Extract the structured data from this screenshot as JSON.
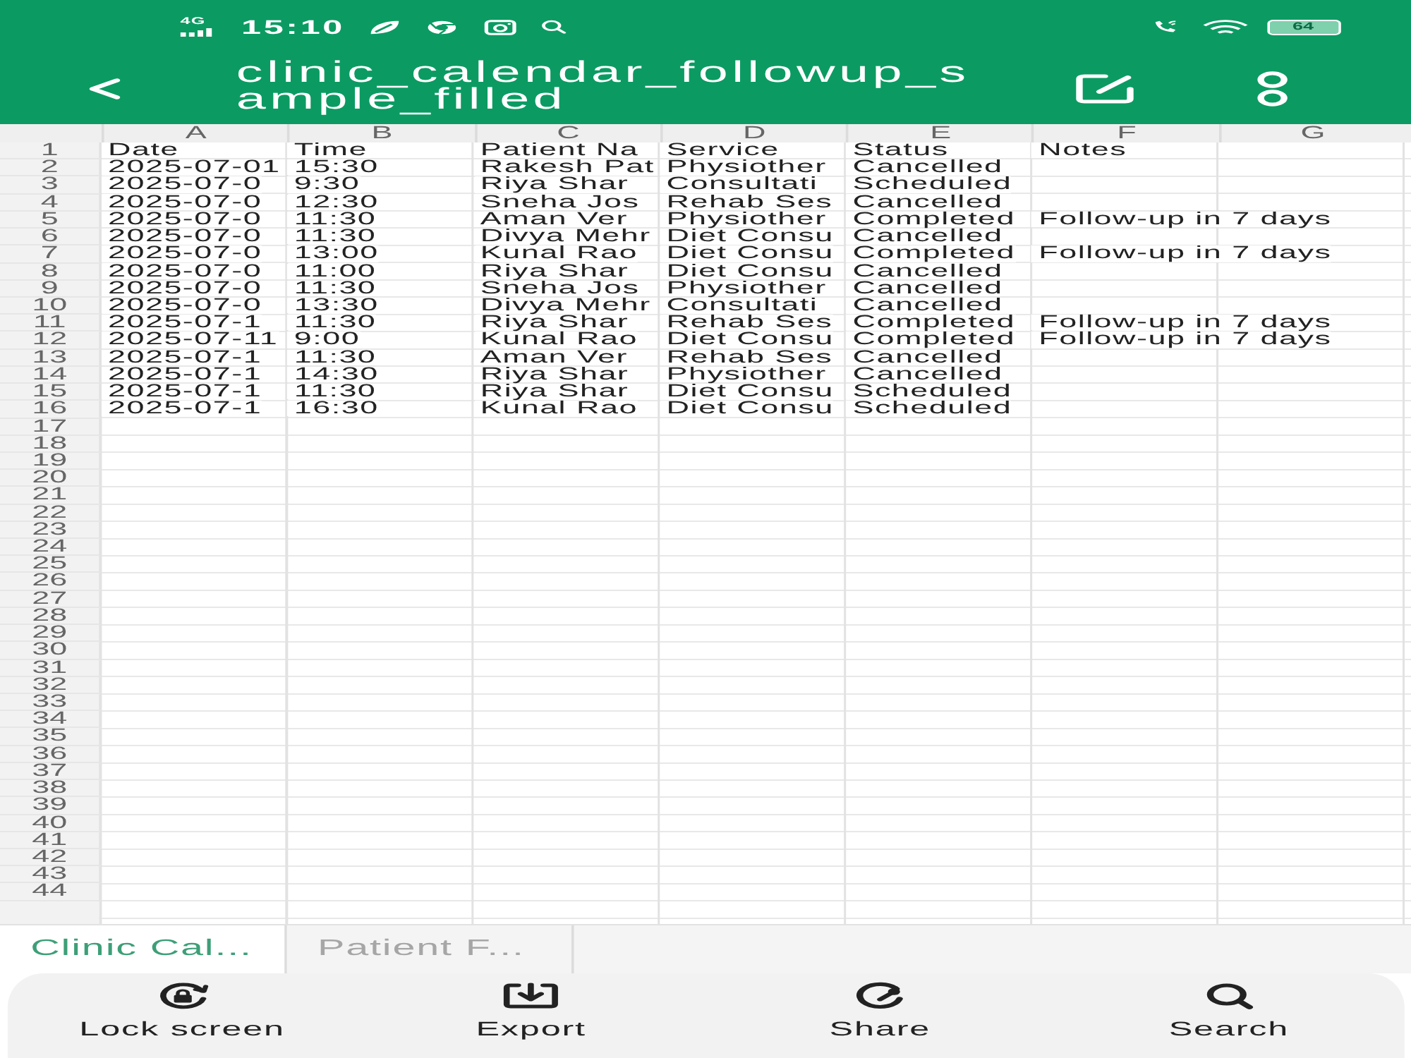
{
  "status_bar": {
    "network": "4G",
    "time": "15:10",
    "battery": "64"
  },
  "title_bar": {
    "title": "clinic_calendar_followup_sample_filled"
  },
  "sheet": {
    "columns": [
      "A",
      "B",
      "C",
      "D",
      "E",
      "F",
      "G"
    ],
    "rows": [
      {
        "number": "1",
        "cells": [
          "Date",
          "Time",
          "Patient Na",
          "Service",
          "Status",
          "Notes"
        ]
      },
      {
        "number": "2",
        "cells": [
          "2025-07-01",
          "15:30",
          "Rakesh Pat",
          "Physiother",
          "Cancelled"
        ]
      },
      {
        "number": "3",
        "cells": [
          "2025-07-0",
          "9:30",
          "Riya Shar",
          "Consultati",
          "Scheduled"
        ]
      },
      {
        "number": "4",
        "cells": [
          "2025-07-0",
          "12:30",
          "Sneha Jos",
          "Rehab Ses",
          "Cancelled"
        ]
      },
      {
        "number": "5",
        "cells": [
          "2025-07-0",
          "11:30",
          "Aman Ver",
          "Physiother",
          "Completed",
          "Follow-up in 7 days"
        ]
      },
      {
        "number": "6",
        "cells": [
          "2025-07-0",
          "11:30",
          "Divya Mehr",
          "Diet Consu",
          "Cancelled"
        ]
      },
      {
        "number": "7",
        "cells": [
          "2025-07-0",
          "13:00",
          "Kunal Rao",
          "Diet Consu",
          "Completed",
          "Follow-up in 7 days"
        ]
      },
      {
        "number": "8",
        "cells": [
          "2025-07-0",
          "11:00",
          "Riya Shar",
          "Diet Consu",
          "Cancelled"
        ]
      },
      {
        "number": "9",
        "cells": [
          "2025-07-0",
          "11:30",
          "Sneha Jos",
          "Physiother",
          "Cancelled"
        ]
      },
      {
        "number": "10",
        "cells": [
          "2025-07-0",
          "13:30",
          "Divya Mehr",
          "Consultati",
          "Cancelled"
        ]
      },
      {
        "number": "11",
        "cells": [
          "2025-07-1",
          "11:30",
          "Riya Shar",
          "Rehab Ses",
          "Completed",
          "Follow-up in 7 days"
        ]
      },
      {
        "number": "12",
        "cells": [
          "2025-07-11",
          "9:00",
          "Kunal Rao",
          "Diet Consu",
          "Completed",
          "Follow-up in 7 days"
        ]
      },
      {
        "number": "13",
        "cells": [
          "2025-07-1",
          "11:30",
          "Aman Ver",
          "Rehab Ses",
          "Cancelled"
        ]
      },
      {
        "number": "14",
        "cells": [
          "2025-07-1",
          "14:30",
          "Riya Shar",
          "Physiother",
          "Cancelled"
        ]
      },
      {
        "number": "15",
        "cells": [
          "2025-07-1",
          "11:30",
          "Riya Shar",
          "Diet Consu",
          "Scheduled"
        ]
      },
      {
        "number": "16",
        "cells": [
          "2025-07-1",
          "16:30",
          "Kunal Rao",
          "Diet Consu",
          "Scheduled"
        ]
      },
      {
        "number": "17"
      },
      {
        "number": "18"
      },
      {
        "number": "19"
      },
      {
        "number": "20"
      },
      {
        "number": "21"
      },
      {
        "number": "22"
      },
      {
        "number": "23"
      },
      {
        "number": "24"
      },
      {
        "number": "25"
      },
      {
        "number": "26"
      },
      {
        "number": "27"
      },
      {
        "number": "28"
      },
      {
        "number": "29"
      },
      {
        "number": "30"
      },
      {
        "number": "31"
      },
      {
        "number": "32"
      },
      {
        "number": "33"
      },
      {
        "number": "34"
      },
      {
        "number": "35"
      },
      {
        "number": "36"
      },
      {
        "number": "37"
      },
      {
        "number": "38"
      },
      {
        "number": "39"
      },
      {
        "number": "40"
      },
      {
        "number": "41"
      },
      {
        "number": "42"
      },
      {
        "number": "43"
      },
      {
        "number": "44"
      }
    ]
  },
  "sheet_tabs": [
    {
      "label": "Clinic Cal...",
      "selected": true
    },
    {
      "label": "Patient F...",
      "selected": false
    }
  ],
  "toolbar": [
    {
      "kind": "lock",
      "label": "Lock screen"
    },
    {
      "kind": "export",
      "label": "Export"
    },
    {
      "kind": "share",
      "label": "Share"
    },
    {
      "kind": "search",
      "label": "Search"
    }
  ]
}
